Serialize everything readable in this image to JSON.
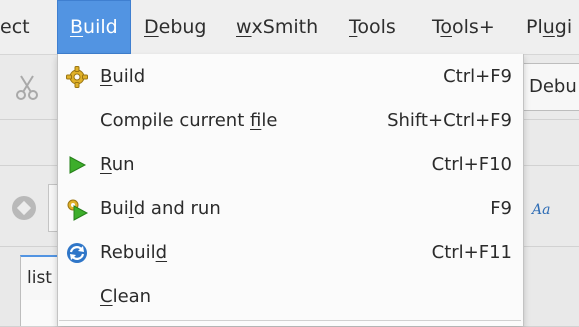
{
  "menubar": {
    "items": [
      {
        "label": "ect"
      },
      {
        "label": "Build",
        "mnemonic": "B",
        "rest": "uild",
        "active": true
      },
      {
        "mnemonic": "D",
        "rest": "ebug"
      },
      {
        "mnemonic": "w",
        "rest": "xSmith"
      },
      {
        "mnemonic": "T",
        "rest": "ools"
      },
      {
        "pre": "T",
        "mnemonic": "o",
        "rest": "ols+"
      },
      {
        "pre": "Pl",
        "mnemonic": "u",
        "rest": "gi"
      }
    ]
  },
  "background": {
    "debug_combo": "Debu",
    "tab_label": "list",
    "font_icon": "Aa"
  },
  "build_menu": {
    "items": [
      {
        "icon": "gear-build-icon",
        "mnemonic": "B",
        "rest": "uild",
        "shortcut": "Ctrl+F9"
      },
      {
        "icon": "",
        "pre": "Compile current ",
        "mnemonic": "f",
        "rest": "ile",
        "shortcut": "Shift+Ctrl+F9"
      },
      {
        "icon": "run-arrow-icon",
        "mnemonic": "R",
        "rest": "un",
        "shortcut": "Ctrl+F10"
      },
      {
        "icon": "build-and-run-icon",
        "pre": "Bui",
        "mnemonic": "l",
        "rest": "d and run",
        "shortcut": "F9"
      },
      {
        "icon": "rebuild-icon",
        "pre": "Rebuil",
        "mnemonic": "d",
        "rest": "",
        "shortcut": "Ctrl+F11"
      },
      {
        "icon": "",
        "mnemonic": "C",
        "rest": "lean",
        "shortcut": ""
      }
    ]
  },
  "colors": {
    "accent": "#5294e2",
    "menu_bg": "#fbfbfb",
    "gear": "#e0b128",
    "run": "#3dae2b",
    "rebuild": "#2f76c8"
  }
}
